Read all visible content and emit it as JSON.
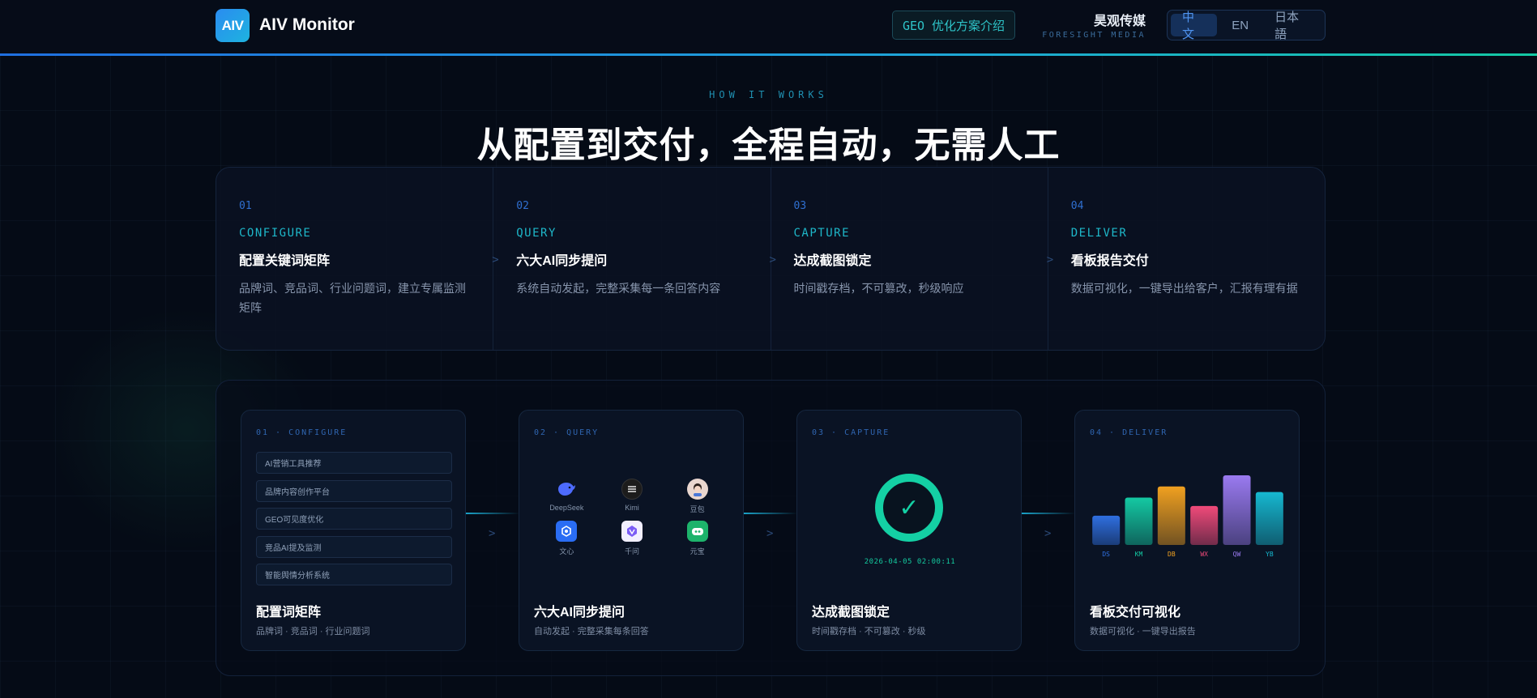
{
  "header": {
    "logo_mark": "AIV",
    "app_name": "AIV Monitor",
    "geo_button": "GEO 优化方案介绍",
    "brand_cn": "昊观传媒",
    "brand_en": "FORESIGHT MEDIA",
    "languages": [
      "中文",
      "EN",
      "日本語"
    ],
    "active_language": "中文"
  },
  "hero": {
    "eyebrow": "HOW IT WORKS",
    "title": "从配置到交付，全程自动，无需人工"
  },
  "steps": [
    {
      "num": "01",
      "key": "CONFIGURE",
      "title": "配置关键词矩阵",
      "desc": "品牌词、竞品词、行业问题词，建立专属监测矩阵"
    },
    {
      "num": "02",
      "key": "QUERY",
      "title": "六大AI同步提问",
      "desc": "系统自动发起，完整采集每一条回答内容"
    },
    {
      "num": "03",
      "key": "CAPTURE",
      "title": "达成截图锁定",
      "desc": "时间戳存档，不可篡改，秒级响应"
    },
    {
      "num": "04",
      "key": "DELIVER",
      "title": "看板报告交付",
      "desc": "数据可视化，一键导出给客户，汇报有理有据"
    }
  ],
  "step_arrow": ">",
  "cards": {
    "configure": {
      "tag": "01 · CONFIGURE",
      "keywords": [
        "AI营销工具推荐",
        "品牌内容创作平台",
        "GEO可见度优化",
        "竞品AI提及监测",
        "智能舆情分析系统"
      ],
      "title": "配置词矩阵",
      "sub": "品牌词 · 竞品词 · 行业问题词"
    },
    "query": {
      "tag": "02 · QUERY",
      "platforms": [
        {
          "name": "DeepSeek",
          "icon": "deepseek-whale-icon",
          "color": "#4d6bfe"
        },
        {
          "name": "Kimi",
          "icon": "kimi-icon",
          "color": "#1c1c1c"
        },
        {
          "name": "豆包",
          "icon": "doubao-avatar-icon",
          "color": "#e9d6cf"
        },
        {
          "name": "文心",
          "icon": "wenxin-icon",
          "color": "#2a6df4"
        },
        {
          "name": "千问",
          "icon": "qianwen-icon",
          "color": "#7b5cf5"
        },
        {
          "name": "元宝",
          "icon": "yuanbao-icon",
          "color": "#1db36b"
        }
      ],
      "title": "六大AI同步提问",
      "sub": "自动发起 · 完整采集每条回答"
    },
    "capture": {
      "tag": "03 · CAPTURE",
      "check": "✓",
      "timestamp": "2026-04-05  02:00:11",
      "title": "达成截图锁定",
      "sub": "时间戳存档 · 不可篡改 · 秒级"
    },
    "deliver": {
      "tag": "04 · DELIVER",
      "title": "看板交付可视化",
      "sub": "数据可视化 · 一键导出报告"
    }
  },
  "chart_data": {
    "type": "bar",
    "categories": [
      "DS",
      "KM",
      "DB",
      "WX",
      "QW",
      "YB"
    ],
    "values": [
      42,
      68,
      84,
      56,
      100,
      76
    ],
    "ylim": [
      0,
      100
    ],
    "colors": [
      "#2f6fe0",
      "#14c9a3",
      "#f0a020",
      "#f04a7a",
      "#9a7af0",
      "#16b8d0"
    ],
    "grid": false
  },
  "colors": {
    "accent_blue": "#2f6fd0",
    "accent_cyan": "#1eb7c9",
    "accent_green": "#14d0a4"
  }
}
